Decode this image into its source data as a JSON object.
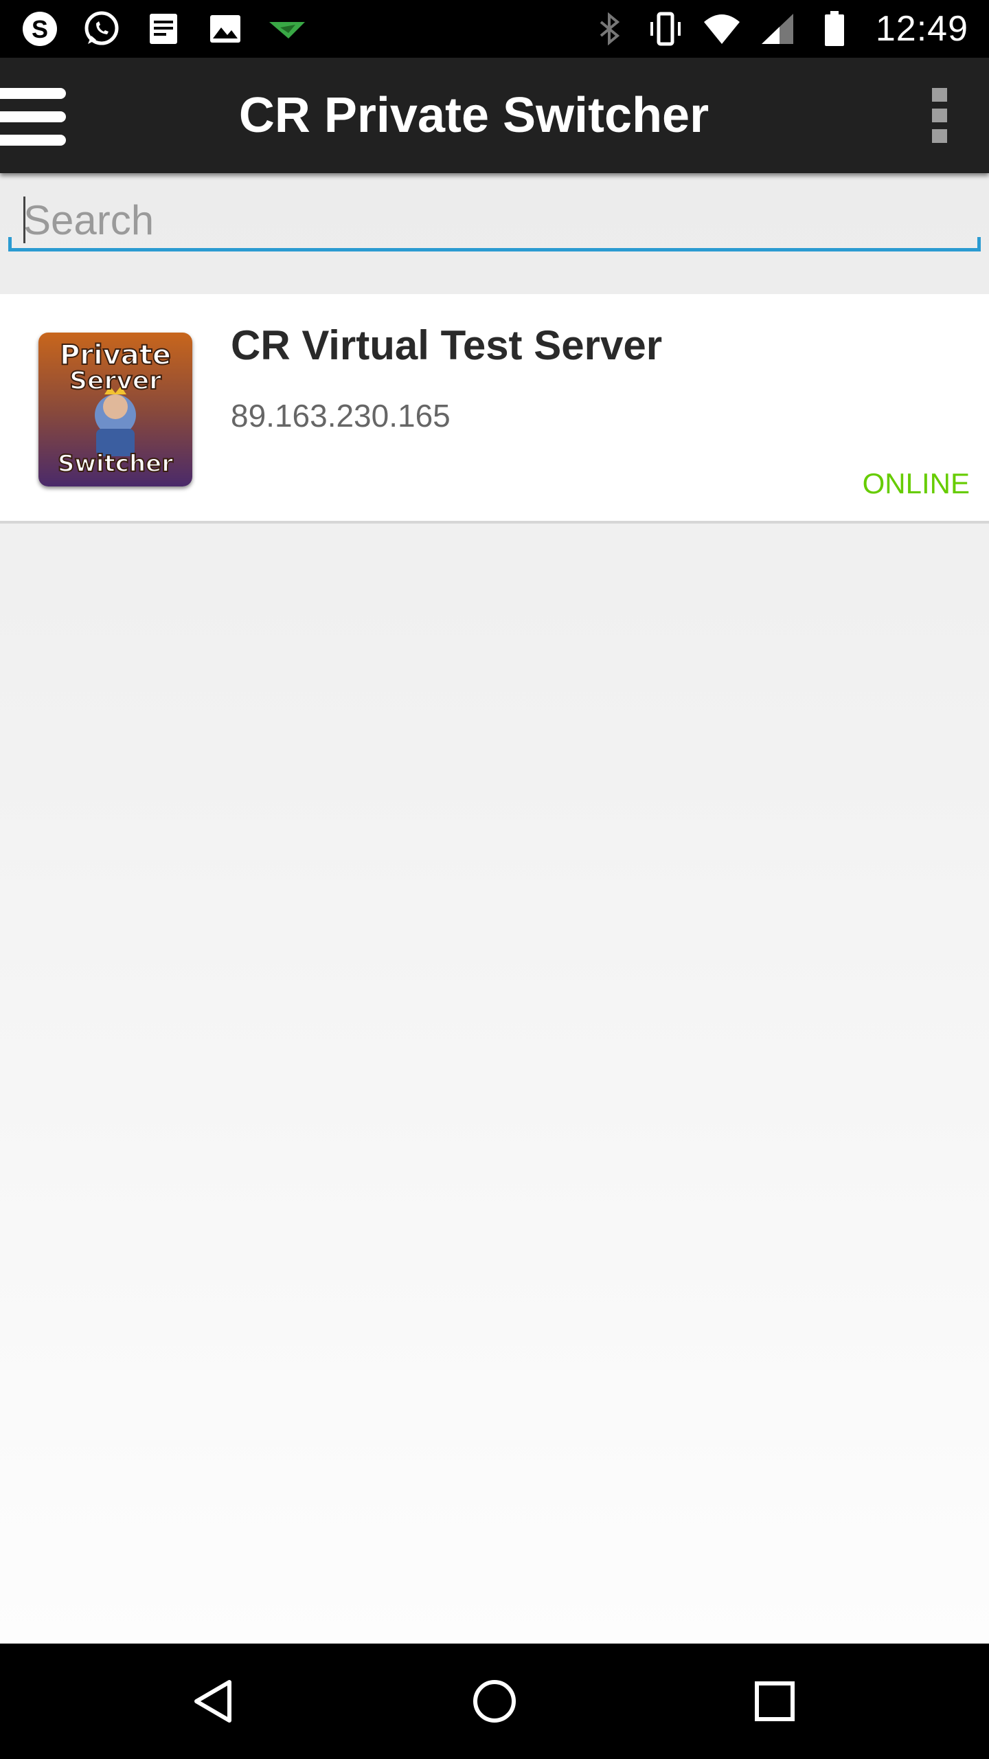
{
  "status_bar": {
    "time": "12:49",
    "left_icons": [
      "skype-icon",
      "whatsapp-icon",
      "notes-icon",
      "gallery-icon",
      "paper-plane-icon"
    ],
    "right_icons": [
      "bluetooth-icon",
      "vibrate-icon",
      "wifi-icon",
      "signal-icon",
      "battery-icon"
    ]
  },
  "app_bar": {
    "title": "CR Private Switcher",
    "menu_icon": "hamburger-menu-icon",
    "overflow_icon": "more-vert-icon"
  },
  "search": {
    "placeholder": "Search",
    "value": ""
  },
  "servers": [
    {
      "name": "CR Virtual Test Server",
      "ip": "89.163.230.165",
      "status": "ONLINE",
      "icon_text": [
        "Private",
        "Server",
        "Switcher"
      ]
    }
  ],
  "nav_bar": {
    "buttons": [
      "back-icon",
      "home-icon",
      "recents-icon"
    ]
  },
  "colors": {
    "app_bar": "#212121",
    "accent": "#2b9bd1",
    "online": "#66cc00"
  }
}
